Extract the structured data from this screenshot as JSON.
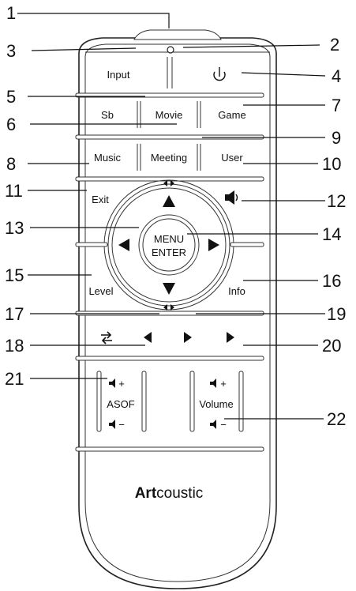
{
  "callouts": [
    "1",
    "2",
    "3",
    "4",
    "5",
    "6",
    "7",
    "8",
    "9",
    "10",
    "11",
    "12",
    "13",
    "14",
    "15",
    "16",
    "17",
    "18",
    "19",
    "20",
    "21",
    "22"
  ],
  "buttons": {
    "input": "Input",
    "sb": "Sb",
    "movie": "Movie",
    "game": "Game",
    "music": "Music",
    "meeting": "Meeting",
    "user": "User",
    "exit": "Exit",
    "level": "Level",
    "info": "Info",
    "menu": "MENU",
    "enter": "ENTER",
    "asof": "ASOF",
    "volume": "Volume",
    "plus": "+",
    "minus": "−"
  },
  "brand": {
    "bold": "Art",
    "rest": "coustic"
  },
  "icons": {
    "power": "power-icon",
    "mute": "speaker-mute-icon",
    "repeat": "repeat-icon",
    "play": "play-icon"
  }
}
